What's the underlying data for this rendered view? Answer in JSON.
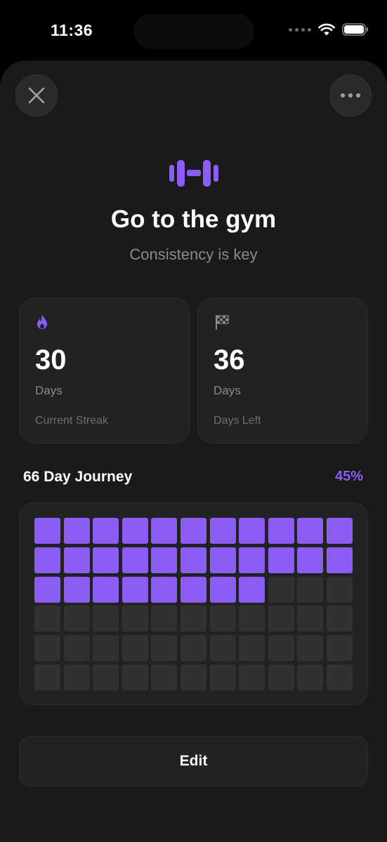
{
  "status_bar": {
    "time": "11:36"
  },
  "habit": {
    "title": "Go to the gym",
    "subtitle": "Consistency is key",
    "icon": "dumbbell-icon",
    "accent_color": "#8b5cf6"
  },
  "stats": [
    {
      "icon": "flame-icon",
      "value": "30",
      "unit": "Days",
      "label": "Current Streak"
    },
    {
      "icon": "checkered-flag-icon",
      "value": "36",
      "unit": "Days",
      "label": "Days Left"
    }
  ],
  "journey": {
    "title": "66 Day Journey",
    "percent_label": "45%",
    "total_days": 66,
    "completed_days": 30,
    "columns": 11
  },
  "actions": {
    "edit_label": "Edit"
  }
}
